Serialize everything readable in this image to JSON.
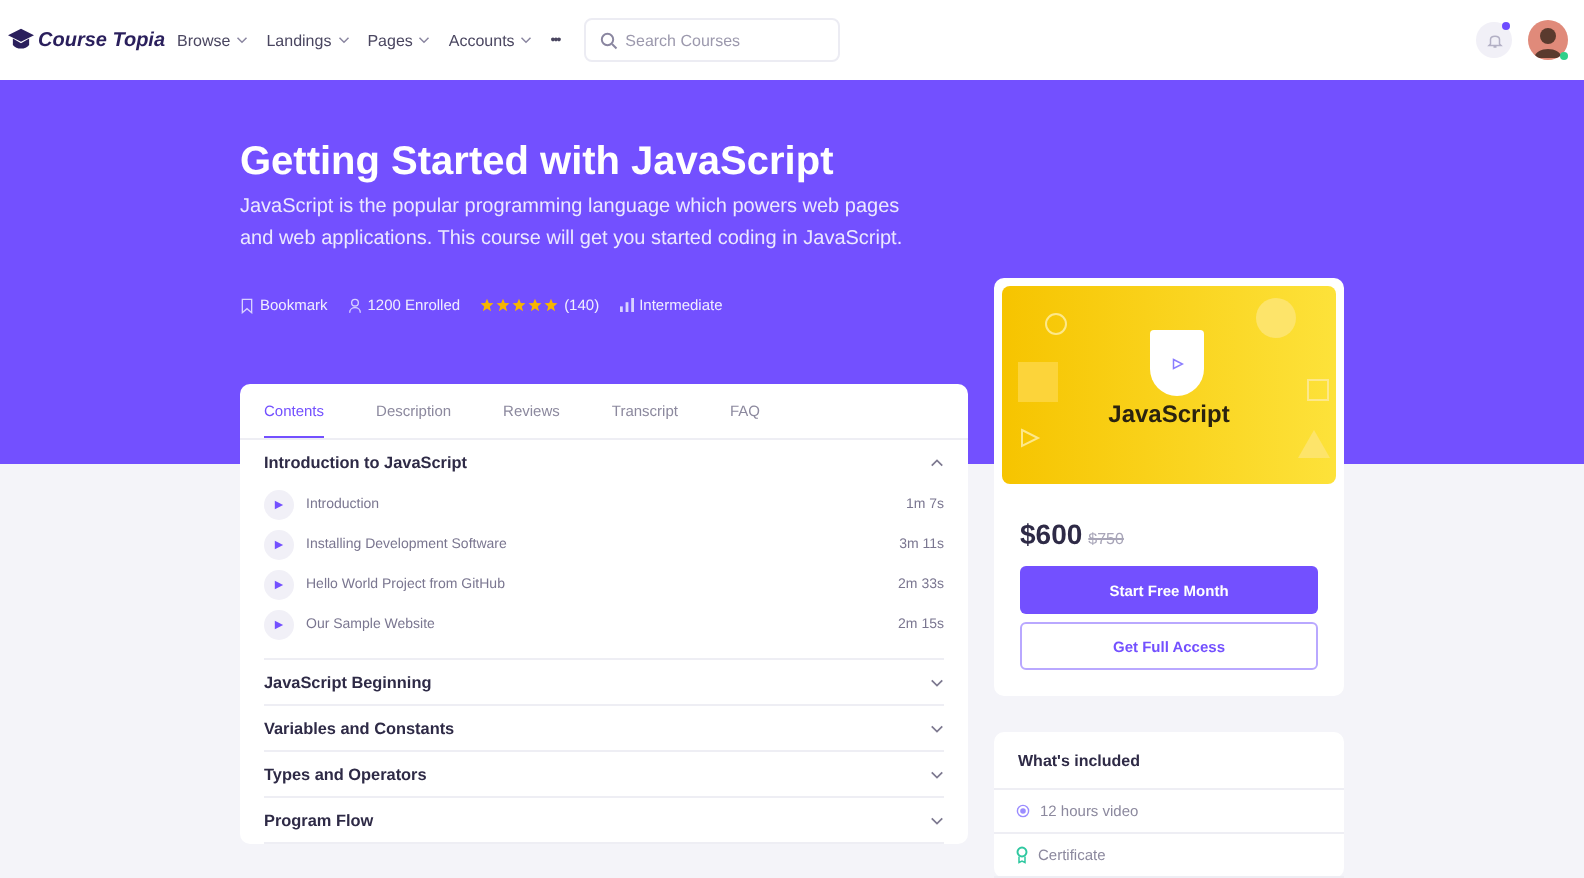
{
  "nav": {
    "brand": "Course Topia",
    "menus": [
      {
        "label": "Browse"
      },
      {
        "label": "Landings"
      },
      {
        "label": "Pages"
      },
      {
        "label": "Accounts"
      }
    ],
    "more": "•••",
    "search": {
      "placeholder": "Search Courses"
    },
    "notification": true,
    "online": true
  },
  "hero": {
    "title": "Getting Started with JavaScript",
    "description": "JavaScript is the popular programming language which powers web pages and web applications. This course will get you started coding in JavaScript.",
    "bookmark": "Bookmark",
    "enrolled": "1200 Enrolled",
    "stars": 5,
    "reviews": "(140)",
    "level": "Intermediate"
  },
  "tabs": [
    {
      "label": "Contents",
      "selected": true
    },
    {
      "label": "Description",
      "selected": false
    },
    {
      "label": "Reviews",
      "selected": false
    },
    {
      "label": "Transcript",
      "selected": false
    },
    {
      "label": "FAQ",
      "selected": false
    }
  ],
  "sections": [
    {
      "title": "Introduction to JavaScript",
      "expanded": true,
      "lessons": [
        {
          "title": "Introduction",
          "duration": "1m 7s"
        },
        {
          "title": "Installing Development Software",
          "duration": "3m 11s"
        },
        {
          "title": "Hello World Project from GitHub",
          "duration": "2m 33s"
        },
        {
          "title": "Our Sample Website",
          "duration": "2m 15s"
        }
      ]
    },
    {
      "title": "JavaScript Beginning",
      "expanded": false
    },
    {
      "title": "Variables and Constants",
      "expanded": false
    },
    {
      "title": "Types and Operators",
      "expanded": false
    },
    {
      "title": "Program Flow",
      "expanded": false
    }
  ],
  "course_card": {
    "thumbnail_title": "JavaScript",
    "price": "$600",
    "old_price": "$750",
    "primary_button": "Start Free Month",
    "secondary_button": "Get Full Access"
  },
  "included": {
    "title": "What's included",
    "items": [
      {
        "kind": "video",
        "label": "12 hours video"
      },
      {
        "kind": "certificate",
        "label": "Certificate"
      }
    ]
  }
}
